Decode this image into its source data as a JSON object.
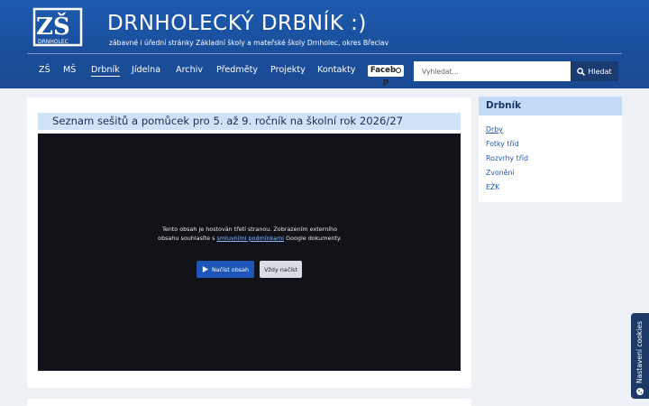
{
  "header": {
    "logo_text": "ZŠ",
    "logo_subtext": "DRNHOLEC",
    "title": "DRNHOLECKÝ DRBNÍK  :)",
    "subtitle": "zábavné i úřední stránky Základní školy a mateřské školy Drnholec, okres Břeclav"
  },
  "nav": {
    "items": [
      {
        "label": "ZŠ"
      },
      {
        "label": "MŠ"
      },
      {
        "label": "Drbník"
      },
      {
        "label": "Jídelna"
      },
      {
        "label": "Archiv"
      },
      {
        "label": "Předměty"
      },
      {
        "label": "Projekty"
      },
      {
        "label": "Kontakty"
      }
    ],
    "active": "Drbník",
    "facebook_label": "Faceb",
    "facebook_label_tail": "p"
  },
  "search": {
    "placeholder": "Vyhledat...",
    "button_label": "Hledat",
    "value": ""
  },
  "article": {
    "title": "Seznam sešitů a pomůcek pro 5. až 9. ročník na školní rok 2026/27"
  },
  "embed": {
    "text_before_link": "Tento obsah je hostován třetí stranou. Zobrazením externího obsahu souhlasíte s ",
    "link_text": "smluvními podmínkami",
    "text_after_link": " Google dokumenty.",
    "load_button": "Načíst obsah",
    "always_button": "Vždy načíst"
  },
  "sidebar": {
    "title": "Drbník",
    "links": [
      {
        "label": "Drby"
      },
      {
        "label": "Fotky tříd"
      },
      {
        "label": "Rozvrhy tříd"
      },
      {
        "label": "Zvonění"
      },
      {
        "label": "EŽK"
      }
    ],
    "active": "Drby"
  },
  "cookie_tab": {
    "label": "Nastavení cookies"
  },
  "colors": {
    "header_blue": "#1a4f9c",
    "title_bar": "#cfe2f7",
    "sidebar_head": "#c3dbf6",
    "button_blue": "#1d56b8",
    "link_blue": "#2457a8"
  }
}
